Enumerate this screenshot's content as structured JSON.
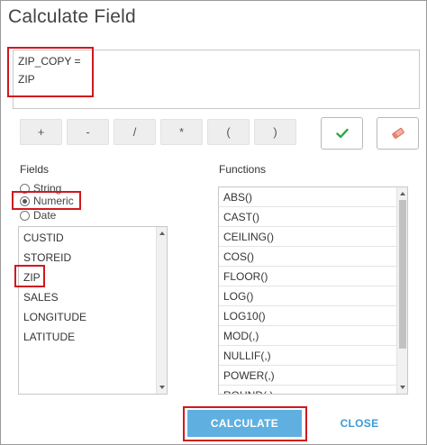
{
  "dialog": {
    "title": "Calculate Field"
  },
  "expression": {
    "label": "ZIP_COPY =",
    "value": "ZIP"
  },
  "operators": [
    "+",
    "-",
    "/",
    "*",
    "(",
    ")"
  ],
  "toolbar": {
    "verify_icon": "checkmark-icon",
    "clear_icon": "eraser-icon",
    "verify_color": "#2ea843",
    "clear_color": "#e88a7a"
  },
  "fields": {
    "label": "Fields",
    "type_options": [
      {
        "label": "String",
        "selected": false
      },
      {
        "label": "Numeric",
        "selected": true
      },
      {
        "label": "Date",
        "selected": false
      }
    ],
    "items": [
      "CUSTID",
      "STOREID",
      "ZIP",
      "SALES",
      "LONGITUDE",
      "LATITUDE"
    ]
  },
  "functions": {
    "label": "Functions",
    "items": [
      "ABS()",
      "CAST()",
      "CEILING()",
      "COS()",
      "FLOOR()",
      "LOG()",
      "LOG10()",
      "MOD(,)",
      "NULLIF(,)",
      "POWER(,)",
      "ROUND(,)"
    ]
  },
  "footer": {
    "calculate_label": "CALCULATE",
    "close_label": "CLOSE"
  },
  "colors": {
    "highlight": "#d0181f",
    "primary_button": "#5fb0e0",
    "link": "#3d9ad6"
  }
}
